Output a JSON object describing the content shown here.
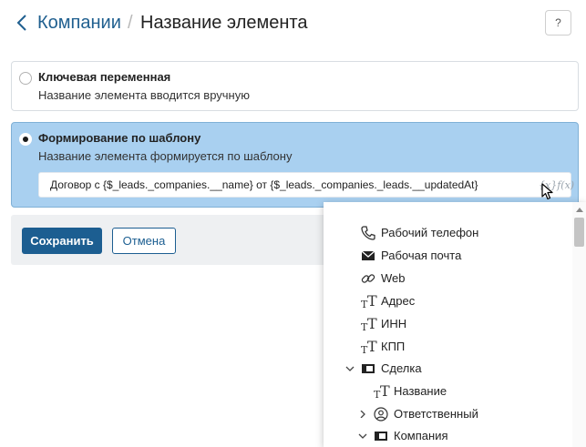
{
  "header": {
    "breadcrumb_link": "Компании",
    "separator": "/",
    "title": "Название элемента",
    "help_label": "?"
  },
  "options": {
    "manual": {
      "title": "Ключевая переменная",
      "description": "Название элемента вводится вручную",
      "selected": false
    },
    "template": {
      "title": "Формирование по шаблону",
      "description": "Название элемента формируется по шаблону",
      "selected": true,
      "value": "Договор с {$_leads._companies.__name} от {$_leads._companies._leads.__updatedAt}",
      "fx_label": "{x}f(x)"
    }
  },
  "actions": {
    "save_label": "Сохранить",
    "cancel_label": "Отмена"
  },
  "dropdown": {
    "items": [
      {
        "label": "Рабочий телефон",
        "icon": "phone-icon"
      },
      {
        "label": "Рабочая почта",
        "icon": "envelope-icon"
      },
      {
        "label": "Web",
        "icon": "link-icon"
      },
      {
        "label": "Адрес",
        "icon": "text-type-icon"
      },
      {
        "label": "ИНН",
        "icon": "text-type-icon"
      },
      {
        "label": "КПП",
        "icon": "text-type-icon"
      },
      {
        "label": "Сделка",
        "icon": "app-icon",
        "expanded": true
      },
      {
        "label": "Название",
        "icon": "text-type-icon"
      },
      {
        "label": "Ответственный",
        "icon": "user-icon",
        "expanded": false
      },
      {
        "label": "Компания",
        "icon": "app-icon",
        "expanded": true
      }
    ]
  },
  "colors": {
    "accent": "#1c5e91",
    "selected_option_bg": "#a9d0f0",
    "link": "#1f5f8f"
  }
}
